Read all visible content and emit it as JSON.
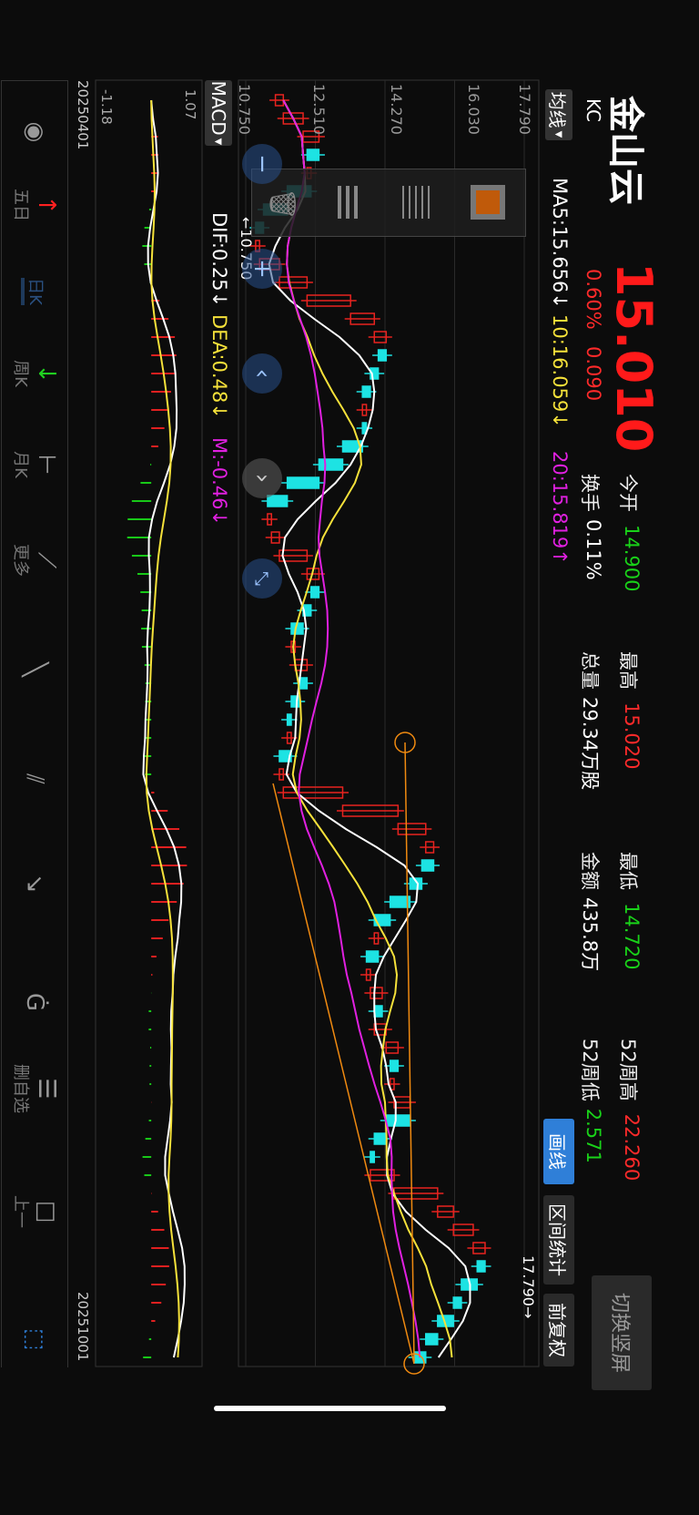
{
  "header": {
    "title": "金山云",
    "code": "KC",
    "price": "15.010",
    "change_pct": "0.60%",
    "change": "0.090",
    "switch_button": "切换竖屏",
    "stats": [
      {
        "label": "今开",
        "value": "14.900",
        "color": "#19d219"
      },
      {
        "label": "换手",
        "value": "0.11%",
        "color": "#ffffff"
      },
      {
        "label": "最高",
        "value": "15.020",
        "color": "#ff2a2a"
      },
      {
        "label": "总量",
        "value": "29.34万股",
        "color": "#ffffff"
      },
      {
        "label": "最低",
        "value": "14.720",
        "color": "#19d219"
      },
      {
        "label": "金额",
        "value": "435.8万",
        "color": "#ffffff"
      },
      {
        "label": "52周高",
        "value": "22.260",
        "color": "#ff2a2a"
      },
      {
        "label": "52周低",
        "value": "2.571",
        "color": "#19d219"
      }
    ]
  },
  "ma_bar": {
    "tab": "均线",
    "ma5": "MA5:15.656↓",
    "ma10": "10:16.059↓",
    "ma20": "20:15.819↑"
  },
  "actions": {
    "draw": "画线",
    "range_stats": "区间统计",
    "adjust": "前复权"
  },
  "macd_bar": {
    "tab": "MACD",
    "dif": "DIF:0.25↓",
    "dea": "DEA:0.48↓",
    "m": "M:-0.46↓"
  },
  "colors": {
    "up": "#e8231f",
    "down": "#1de3e3",
    "ma5": "#ffffff",
    "ma10": "#f5e13a",
    "ma20": "#e020e0",
    "accent": "#2f7fd8",
    "drawing": "#f08a10"
  },
  "chart_data": {
    "type": "candlestick",
    "y_ticks": [
      "17.790",
      "16.030",
      "14.270",
      "12.510",
      "10.750"
    ],
    "ylim": [
      10.75,
      17.79
    ],
    "max_marker": "17.790→",
    "min_marker": "←10.750",
    "macd_ticks": [
      "1.07",
      "-1.18"
    ],
    "macd_ylim": [
      -1.18,
      1.07
    ],
    "x_labels": [
      "20250401",
      "20251001"
    ],
    "closes": [
      11.7,
      12.2,
      12.6,
      12.3,
      12.4,
      11.8,
      11.2,
      11.0,
      11.1,
      11.6,
      12.3,
      13.4,
      14.0,
      14.3,
      14.1,
      13.9,
      13.7,
      13.8,
      13.7,
      13.2,
      12.6,
      11.8,
      11.3,
      11.4,
      11.6,
      12.3,
      12.6,
      12.4,
      12.2,
      11.9,
      12.0,
      12.3,
      12.1,
      11.9,
      11.8,
      11.9,
      11.6,
      11.7,
      13.2,
      14.6,
      15.3,
      15.5,
      15.2,
      14.9,
      14.4,
      14.0,
      14.1,
      13.8,
      13.9,
      14.2,
      14.0,
      14.3,
      14.6,
      14.4,
      14.5,
      14.9,
      14.3,
      14.0,
      13.9,
      14.5,
      15.6,
      16.0,
      16.5,
      16.8,
      16.6,
      16.2,
      16.0,
      15.6,
      15.3,
      15.01
    ]
  },
  "toolbar": [
    {
      "icon": "eye-icon",
      "label": ""
    },
    {
      "icon": "up-arrow-icon",
      "label": "五日"
    },
    {
      "icon": "",
      "label": "日K"
    },
    {
      "icon": "down-arrow-icon",
      "label": "周K"
    },
    {
      "icon": "horizontal-line-icon",
      "label": "月K"
    },
    {
      "icon": "polyline-icon",
      "label": "更多"
    },
    {
      "icon": "line-segment-icon",
      "label": ""
    },
    {
      "icon": "parallel-lines-icon",
      "label": ""
    },
    {
      "icon": "arrow-line-icon",
      "label": ""
    },
    {
      "icon": "golden-ratio-icon",
      "label": ""
    },
    {
      "icon": "fib-lines-icon",
      "label": "删自选"
    },
    {
      "icon": "rectangle-icon",
      "label": "上一"
    },
    {
      "icon": "expand-icon",
      "label": ""
    }
  ]
}
